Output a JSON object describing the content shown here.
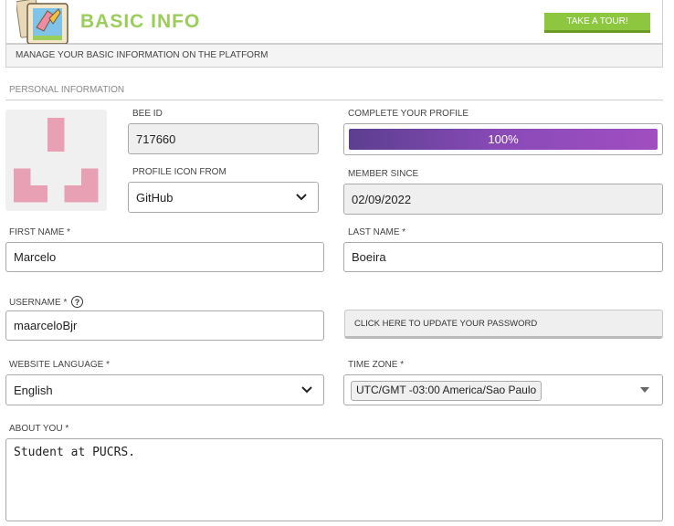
{
  "header": {
    "title": "BASIC INFO",
    "tour_button": "TAKE A TOUR!",
    "subtitle": "MANAGE YOUR BASIC INFORMATION ON THE PLATFORM",
    "icon": "profile-card-icon"
  },
  "section": {
    "label": "PERSONAL INFORMATION"
  },
  "profile": {
    "avatar_color": "#e8a0b4",
    "bee_id_label": "BEE ID",
    "bee_id": "717660",
    "icon_from_label": "PROFILE ICON FROM",
    "icon_from_value": "GitHub",
    "complete_label": "COMPLETE YOUR PROFILE",
    "complete_percent": 100,
    "complete_text": "100%",
    "member_since_label": "MEMBER SINCE",
    "member_since": "02/09/2022"
  },
  "form": {
    "first_name_label": "FIRST NAME *",
    "first_name": "Marcelo",
    "last_name_label": "LAST NAME *",
    "last_name": "Boeira",
    "username_label": "USERNAME *",
    "username": "maarceloBjr",
    "update_password": "CLICK HERE TO UPDATE YOUR PASSWORD",
    "language_label": "WEBSITE LANGUAGE *",
    "language": "English",
    "timezone_label": "TIME ZONE *",
    "timezone": "UTC/GMT -03:00 America/Sao Paulo",
    "about_label": "ABOUT YOU *",
    "about": "Student at PUCRS."
  },
  "colors": {
    "accent_green": "#8dc63f",
    "title_green": "#9acd5a",
    "progress_purple": "#8a4ab8"
  }
}
